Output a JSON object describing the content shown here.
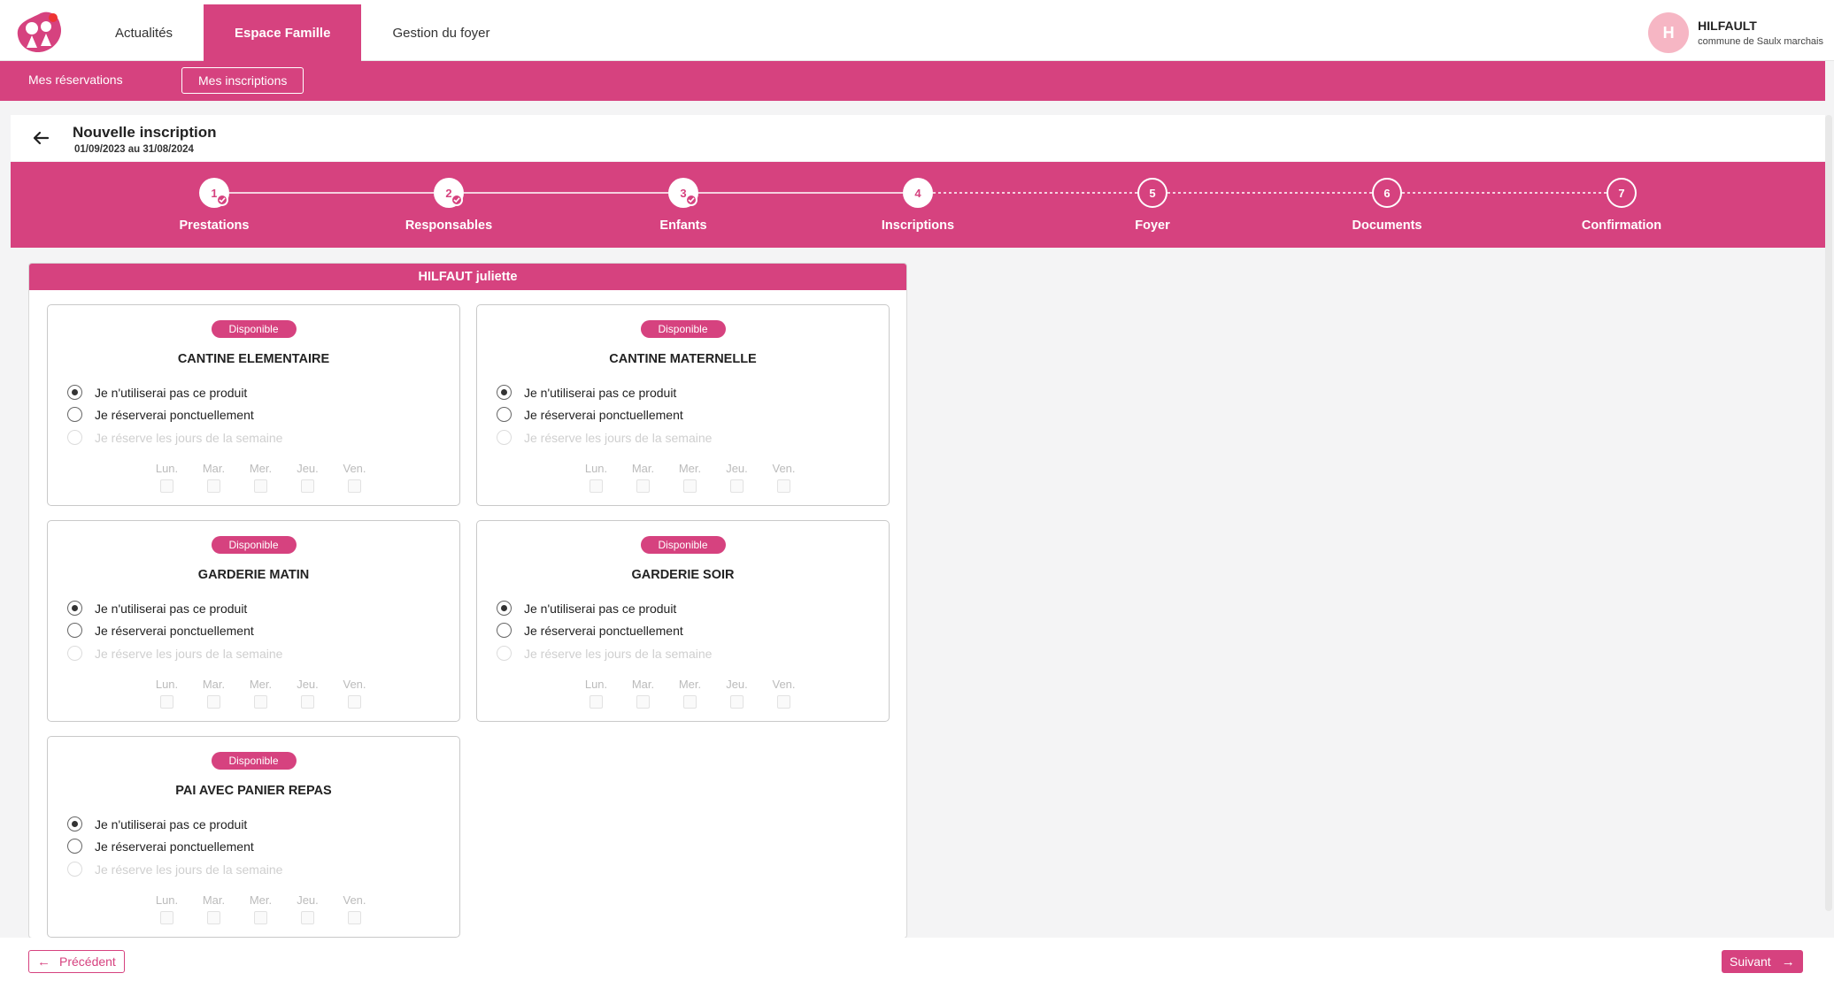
{
  "colors": {
    "accent": "#d6427f",
    "avatar": "#f6b6c4"
  },
  "topnav": {
    "items": [
      {
        "label": "Actualités"
      },
      {
        "label": "Espace Famille"
      },
      {
        "label": "Gestion du foyer"
      }
    ],
    "active_index": 1
  },
  "user": {
    "initial": "H",
    "name": "HILFAULT",
    "commune": "commune de Saulx marchais"
  },
  "subnav": {
    "reservations": "Mes réservations",
    "inscriptions": "Mes inscriptions",
    "active": "inscriptions"
  },
  "page": {
    "title": "Nouvelle inscription",
    "dates": "01/09/2023 au 31/08/2024"
  },
  "steps": [
    {
      "num": "1",
      "label": "Prestations",
      "status": "done"
    },
    {
      "num": "2",
      "label": "Responsables",
      "status": "done"
    },
    {
      "num": "3",
      "label": "Enfants",
      "status": "done"
    },
    {
      "num": "4",
      "label": "Inscriptions",
      "status": "current"
    },
    {
      "num": "5",
      "label": "Foyer",
      "status": "todo"
    },
    {
      "num": "6",
      "label": "Documents",
      "status": "todo"
    },
    {
      "num": "7",
      "label": "Confirmation",
      "status": "todo"
    }
  ],
  "child": {
    "name": "HILFAUT juliette"
  },
  "option_labels": {
    "none": "Je n'utiliserai pas ce produit",
    "occasional": "Je réserverai ponctuellement",
    "weekly": "Je réserve les jours de la semaine"
  },
  "days": [
    "Lun.",
    "Mar.",
    "Mer.",
    "Jeu.",
    "Ven."
  ],
  "products": [
    {
      "badge": "Disponible",
      "title": "CANTINE ELEMENTAIRE",
      "selected": "none"
    },
    {
      "badge": "Disponible",
      "title": "CANTINE MATERNELLE",
      "selected": "none"
    },
    {
      "badge": "Disponible",
      "title": "GARDERIE MATIN",
      "selected": "none"
    },
    {
      "badge": "Disponible",
      "title": "GARDERIE SOIR",
      "selected": "none"
    },
    {
      "badge": "Disponible",
      "title": "PAI AVEC PANIER REPAS",
      "selected": "none"
    }
  ],
  "footer": {
    "prev": "Précédent",
    "next": "Suivant"
  }
}
